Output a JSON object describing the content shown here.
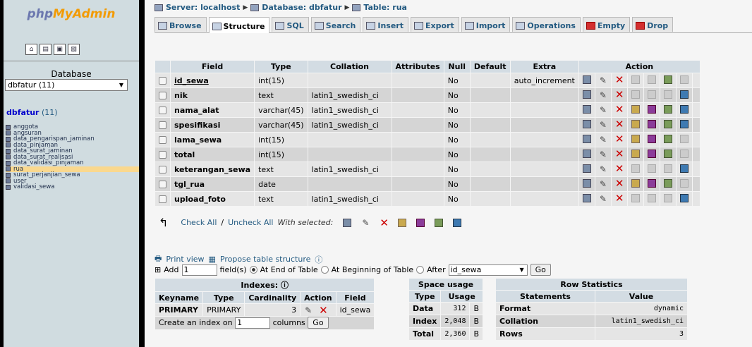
{
  "logo": {
    "php": "php",
    "my": "My",
    "admin": "Admin"
  },
  "sidebar": {
    "database_label": "Database",
    "database_selected": "dbfatur (11)",
    "db_link": "dbfatur",
    "db_count": " (11)",
    "tables": [
      "anggota",
      "angsuran",
      "data_pengarispan_jaminan",
      "data_pinjaman",
      "data_surat_jaminan",
      "data_surat_realisasi",
      "data_validasi_pinjaman",
      "rua",
      "surat_perjanjian_sewa",
      "user",
      "validasi_sewa"
    ],
    "selected_table": "rua"
  },
  "breadcrumb": {
    "server": "Server: localhost",
    "database": "Database: dbfatur",
    "table": "Table: rua"
  },
  "tabs": [
    "Browse",
    "Structure",
    "SQL",
    "Search",
    "Insert",
    "Export",
    "Import",
    "Operations",
    "Empty",
    "Drop"
  ],
  "active_tab": "Structure",
  "structure": {
    "headers": [
      "Field",
      "Type",
      "Collation",
      "Attributes",
      "Null",
      "Default",
      "Extra",
      "Action"
    ],
    "rows": [
      {
        "field": "id_sewa",
        "type": "int(15)",
        "collation": "",
        "attributes": "",
        "null": "No",
        "default": "",
        "extra": "auto_increment"
      },
      {
        "field": "nik",
        "type": "text",
        "collation": "latin1_swedish_ci",
        "attributes": "",
        "null": "No",
        "default": "",
        "extra": ""
      },
      {
        "field": "nama_alat",
        "type": "varchar(45)",
        "collation": "latin1_swedish_ci",
        "attributes": "",
        "null": "No",
        "default": "",
        "extra": ""
      },
      {
        "field": "spesifikasi",
        "type": "varchar(45)",
        "collation": "latin1_swedish_ci",
        "attributes": "",
        "null": "No",
        "default": "",
        "extra": ""
      },
      {
        "field": "lama_sewa",
        "type": "int(15)",
        "collation": "",
        "attributes": "",
        "null": "No",
        "default": "",
        "extra": ""
      },
      {
        "field": "total",
        "type": "int(15)",
        "collation": "",
        "attributes": "",
        "null": "No",
        "default": "",
        "extra": ""
      },
      {
        "field": "keterangan_sewa",
        "type": "text",
        "collation": "latin1_swedish_ci",
        "attributes": "",
        "null": "No",
        "default": "",
        "extra": ""
      },
      {
        "field": "tgl_rua",
        "type": "date",
        "collation": "",
        "attributes": "",
        "null": "No",
        "default": "",
        "extra": ""
      },
      {
        "field": "upload_foto",
        "type": "text",
        "collation": "latin1_swedish_ci",
        "attributes": "",
        "null": "No",
        "default": "",
        "extra": ""
      }
    ]
  },
  "bulk": {
    "check_all": "Check All",
    "uncheck_all": "Uncheck All",
    "with_selected": "With selected:"
  },
  "links": {
    "print_view": "Print view",
    "propose": "Propose table structure"
  },
  "add_field": {
    "add": "Add",
    "count": "1",
    "fields_text": "field(s)",
    "end": "At End of Table",
    "beginning": "At Beginning of Table",
    "after": "After",
    "after_field": "id_sewa",
    "go": "Go"
  },
  "indexes": {
    "title": "Indexes:",
    "headers": [
      "Keyname",
      "Type",
      "Cardinality",
      "Action",
      "Field"
    ],
    "row": {
      "keyname": "PRIMARY",
      "type": "PRIMARY",
      "cardinality": "3",
      "field": "id_sewa"
    },
    "create_label": "Create an index on",
    "create_count": "1",
    "columns": "columns",
    "go": "Go"
  },
  "space": {
    "title": "Space usage",
    "headers": [
      "Type",
      "Usage"
    ],
    "rows": [
      {
        "type": "Data",
        "value": "312",
        "unit": "B"
      },
      {
        "type": "Index",
        "value": "2,048",
        "unit": "B"
      },
      {
        "type": "Total",
        "value": "2,360",
        "unit": "B"
      }
    ]
  },
  "rowstats": {
    "title": "Row Statistics",
    "headers": [
      "Statements",
      "Value"
    ],
    "rows": [
      {
        "k": "Format",
        "v": "dynamic"
      },
      {
        "k": "Collation",
        "v": "latin1_swedish_ci"
      },
      {
        "k": "Rows",
        "v": "3"
      }
    ]
  }
}
